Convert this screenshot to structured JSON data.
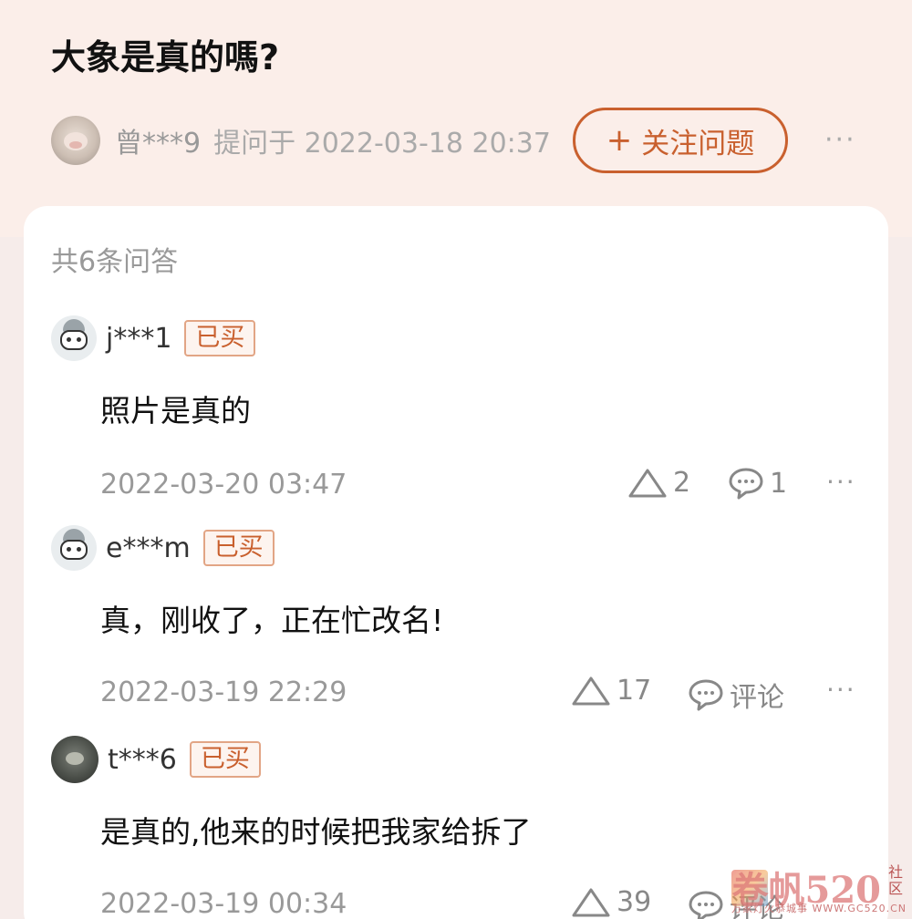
{
  "question": {
    "title": "大象是真的嗎?",
    "asker": "曾***9",
    "meta": "提问于 2022-03-18 20:37",
    "follow_label": "关注问题",
    "follow_icon": "+",
    "more": "···"
  },
  "answers_count": "共6条问答",
  "answers": [
    {
      "user": "j***1",
      "badge": "已买",
      "text": "照片是真的",
      "date": "2022-03-20 03:47",
      "likes": "2",
      "comments": "1",
      "more": "···",
      "avatar": "robot-avatar"
    },
    {
      "user": "e***m",
      "badge": "已买",
      "text": "真，刚收了，正在忙改名!",
      "date": "2022-03-19 22:29",
      "likes": "17",
      "comments": "评论",
      "more": "···",
      "avatar": "robot-avatar"
    },
    {
      "user": "t***6",
      "badge": "已买",
      "text": "是真的,他来的时候把我家给拆了",
      "date": "2022-03-19 00:34",
      "likes": "39",
      "comments": "评论",
      "avatar": "photo-avatar"
    }
  ],
  "watermark": {
    "main": "卷帆520",
    "side": "社区",
    "sub": "万家灯火恭城事 WWW.GC520.CN"
  },
  "colors": {
    "accent": "#c9602e",
    "header_bg": "#fbeee9",
    "muted": "#999999"
  }
}
